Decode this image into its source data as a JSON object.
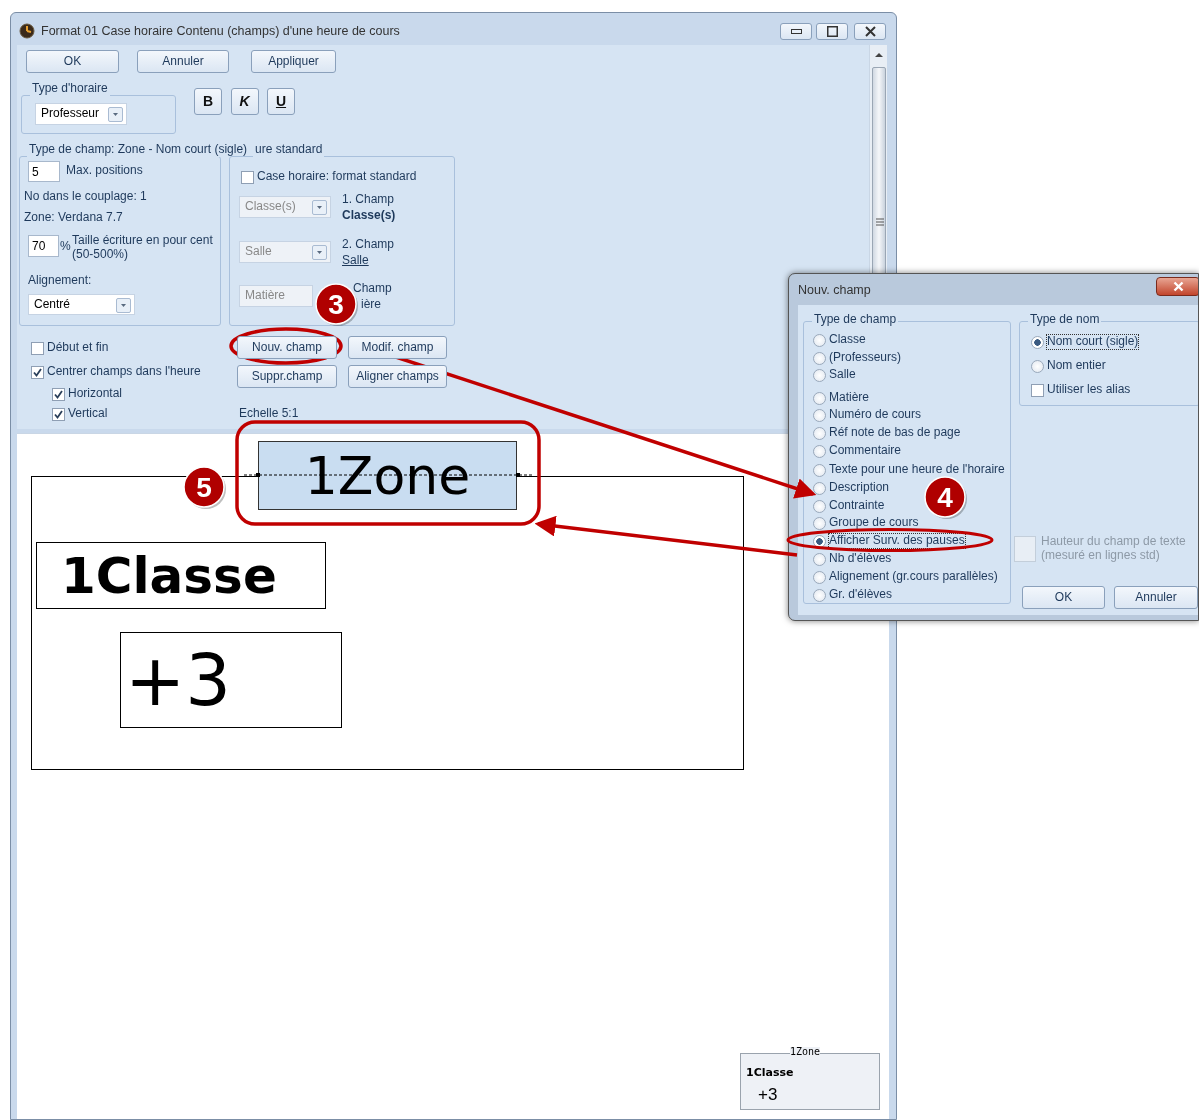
{
  "window": {
    "title": "Format 01  Case horaire  Contenu (champs) d'une heure de cours"
  },
  "top_buttons": [
    {
      "label": "OK"
    },
    {
      "label": "Annuler"
    },
    {
      "label": "Appliquer"
    }
  ],
  "schedule_type": {
    "legend": "Type d'horaire",
    "value": "Professeur"
  },
  "format_buttons": [
    {
      "label": "B",
      "kind": "bold"
    },
    {
      "label": "K",
      "kind": "italic"
    },
    {
      "label": "U",
      "kind": "underline"
    }
  ],
  "field_group": {
    "legend": "Type de champ: Zone - Nom court (sigle)",
    "max_positions": "5",
    "max_positions_label": "Max. positions",
    "coupling": "No dans le couplage: 1",
    "zone_font": "Zone: Verdana 7.7",
    "size_value": "70",
    "size_unit": "%",
    "size_label": "Taille écriture en pour cent",
    "size_range": "(50-500%)",
    "alignment_label": "Alignement:",
    "alignment_value": "Centré"
  },
  "standard_group": {
    "legend": "ure standard",
    "checkbox": {
      "label": "Case horaire: format standard",
      "checked": false
    },
    "fields": [
      {
        "select": "Classe(s)",
        "number": "1. Champ",
        "name": "Classe(s)",
        "kind": "bold"
      },
      {
        "select": "Salle",
        "number": "2. Champ",
        "name": "Salle",
        "kind": "underline"
      },
      {
        "select": "Matière",
        "number": "Champ",
        "name": "ière",
        "kind": "plain"
      }
    ]
  },
  "options": [
    {
      "label": "Début et fin",
      "checked": false
    },
    {
      "label": "Centrer champs dans l'heure",
      "checked": true,
      "children": [
        {
          "label": "Horizontal",
          "checked": true
        },
        {
          "label": "Vertical",
          "checked": true
        }
      ]
    }
  ],
  "field_buttons": [
    {
      "label": "Nouv. champ"
    },
    {
      "label": "Modif. champ"
    },
    {
      "label": "Suppr.champ"
    },
    {
      "label": "Aligner champs"
    }
  ],
  "scale": "Echelle  5:1",
  "canvas": {
    "fields": [
      {
        "text": "1Zone",
        "kind": "zone",
        "selected": true
      },
      {
        "text": "1Classe",
        "kind": "class",
        "selected": false
      },
      {
        "text": "+3",
        "kind": "count",
        "selected": false
      }
    ]
  },
  "preview": {
    "title": "1Zone",
    "lines": [
      {
        "text": "1Classe",
        "kind": "bold"
      },
      {
        "text": "+3",
        "kind": "plain"
      }
    ]
  },
  "dialog": {
    "title": "Nouv. champ",
    "field_type": {
      "legend": "Type de champ",
      "options": [
        {
          "label": "Classe",
          "selected": false
        },
        {
          "label": "(Professeurs)",
          "selected": false
        },
        {
          "label": "Salle",
          "selected": false
        },
        {
          "label": "Matière",
          "selected": false
        },
        {
          "label": "Numéro de cours",
          "selected": false
        },
        {
          "label": "Réf note de bas de page",
          "selected": false
        },
        {
          "label": "Commentaire",
          "selected": false
        },
        {
          "label": "Texte pour une heure de l'horaire",
          "selected": false
        },
        {
          "label": "Description",
          "selected": false
        },
        {
          "label": "Contrainte",
          "selected": false
        },
        {
          "label": "Groupe de cours",
          "selected": false
        },
        {
          "label": "Afficher Surv. des pauses",
          "selected": true
        },
        {
          "label": "Nb d'élèves",
          "selected": false
        },
        {
          "label": "Alignement (gr.cours parallèles)",
          "selected": false
        },
        {
          "label": "Gr. d'élèves",
          "selected": false
        }
      ]
    },
    "name_type": {
      "legend": "Type de nom",
      "options": [
        {
          "label": "Nom court (sigle)",
          "selected": true
        },
        {
          "label": "Nom entier",
          "selected": false
        }
      ],
      "alias": {
        "label": "Utiliser les alias",
        "checked": false
      }
    },
    "height": {
      "label": "Hauteur du champ de texte",
      "sublabel": "(mesuré en lignes std)",
      "disabled": true
    },
    "buttons": [
      {
        "label": "OK"
      },
      {
        "label": "Annuler"
      }
    ]
  },
  "annotations": [
    {
      "label": "3"
    },
    {
      "label": "4"
    },
    {
      "label": "5"
    }
  ]
}
